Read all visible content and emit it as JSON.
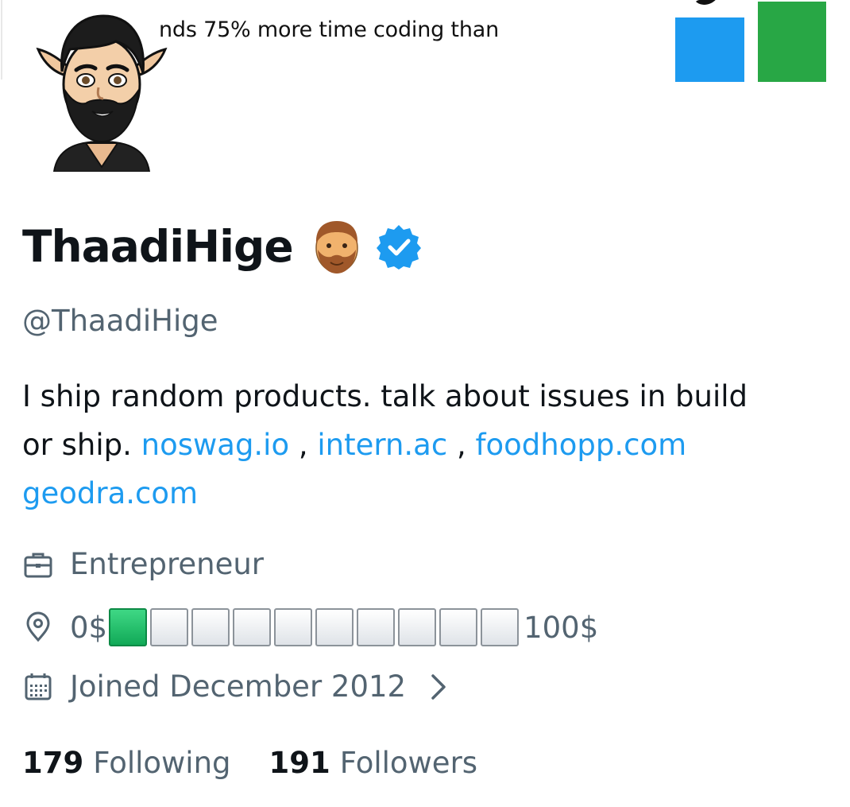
{
  "banner": {
    "text": "nds 75% more time coding than",
    "colors": {
      "blue_square": "#1d9bf0",
      "green_square": "#28a745"
    }
  },
  "profile": {
    "avatar_icon": "cartoon-bearded-elf-avatar",
    "display_name": "ThaadiHige",
    "name_emoji_icon": "bearded-person-emoji",
    "verified_icon": "verified-badge-icon",
    "handle": "@ThaadiHige",
    "bio": {
      "text_line1": "I ship random products. talk about issues in build",
      "text_line2_prefix": "or ship. ",
      "links": [
        "noswag.io",
        "intern.ac",
        "foodhopp.com",
        "geodra.com"
      ],
      "separator": " , "
    },
    "profession": {
      "icon": "briefcase-icon",
      "label": "Entrepreneur"
    },
    "location": {
      "icon": "location-pin-icon",
      "start": "0$",
      "end": "100$",
      "progress_filled": 1,
      "progress_total": 10
    },
    "joined": {
      "icon": "calendar-icon",
      "label": "Joined December 2012",
      "chevron_icon": "chevron-right-icon"
    },
    "stats": {
      "following_count": "179",
      "following_label": "Following",
      "followers_count": "191",
      "followers_label": "Followers"
    }
  },
  "colors": {
    "link": "#1d9bf0",
    "secondary_text": "#536471",
    "primary_text": "#0f1419"
  }
}
